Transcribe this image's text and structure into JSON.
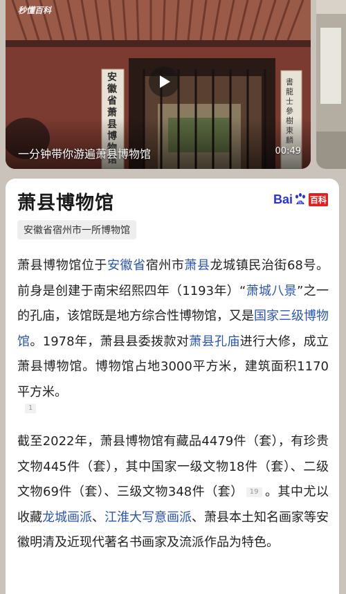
{
  "video": {
    "watermark": "秒懂百科",
    "caption": "一分钟带你游遍萧县博物馆",
    "duration": "00:49",
    "gate_plaque": "安徽省萧县博物馆",
    "side_plaque": "書龍士參樹東麟"
  },
  "article": {
    "title": "萧县博物馆",
    "logo": {
      "bai": "Bai",
      "du": "du",
      "baike": "百科"
    },
    "subtitle": "安徽省宿州市一所博物馆",
    "para1": [
      {
        "t": "萧县博物馆位于",
        "link": false
      },
      {
        "t": "安徽省",
        "link": true
      },
      {
        "t": "宿州市",
        "link": false
      },
      {
        "t": "萧县",
        "link": true
      },
      {
        "t": "龙城镇民治街68号。前身是创建于南宋绍熙四年（1193年）“",
        "link": false
      },
      {
        "t": "萧城八景",
        "link": true
      },
      {
        "t": "”之一的孔庙，该馆既是地方综合性博物馆，又是",
        "link": false
      },
      {
        "t": "国家三级博物馆",
        "link": true
      },
      {
        "t": "。1978年，萧县县委拨款对",
        "link": false
      },
      {
        "t": "萧县孔庙",
        "link": true
      },
      {
        "t": "进行大修，成立萧县博物馆。博物馆占地3000平方米，建筑面积1170平方米。",
        "link": false
      }
    ],
    "cite1": "1",
    "para2_before_cite": "截至2022年，萧县博物馆有藏品4479件（套），有珍贵文物445件（套），其中国家一级文物18件（套）、二级文物69件（套）、三级文物348件（套）",
    "cite2": "19",
    "para2_after": [
      {
        "t": "。其中尤以收藏",
        "link": false
      },
      {
        "t": "龙城画派",
        "link": true
      },
      {
        "t": "、",
        "link": false
      },
      {
        "t": "江淮大写意画派",
        "link": true
      },
      {
        "t": "、萧县本土知名画家等安徽明清及近现代著名书画家及流派作品为特色。",
        "link": false
      }
    ]
  },
  "colors": {
    "link": "#2a55b5",
    "text": "#222222",
    "tag_bg": "#eeeeee",
    "baidu_blue": "#2932e1",
    "baike_red": "#e02020"
  },
  "icons": [
    "play-icon",
    "baidu-paw-icon"
  ]
}
